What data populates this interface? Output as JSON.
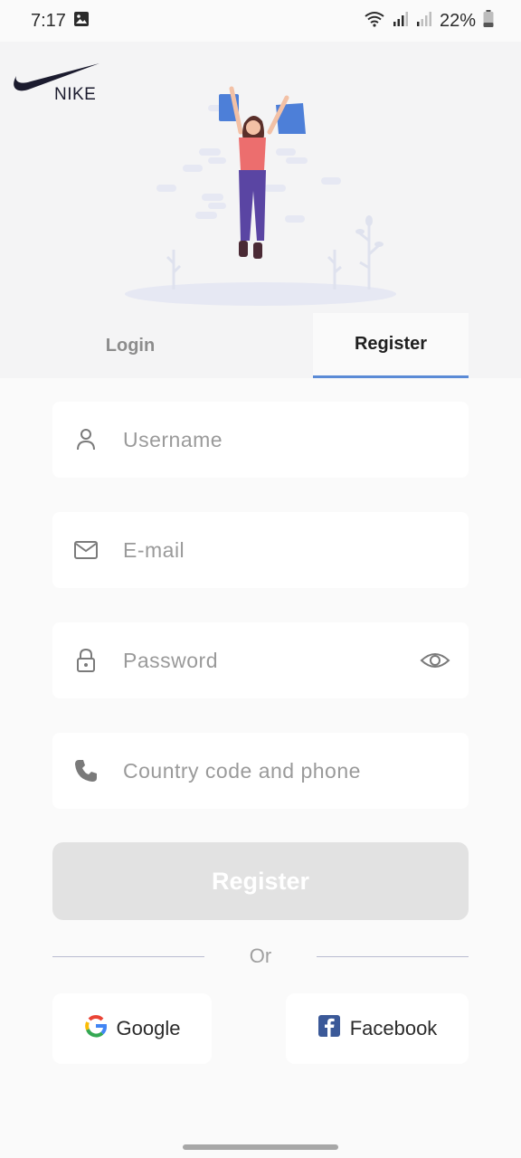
{
  "status_bar": {
    "time": "7:17",
    "battery": "22%",
    "icons": [
      "image-icon",
      "wifi-icon",
      "signal-icon",
      "signal-icon-2",
      "battery-icon"
    ]
  },
  "logo": {
    "text": "NIKE"
  },
  "tabs": {
    "login": "Login",
    "register": "Register",
    "active": "register"
  },
  "form": {
    "username_placeholder": "Username",
    "email_placeholder": "E-mail",
    "password_placeholder": "Password",
    "phone_placeholder": "Country code and phone"
  },
  "register_button": "Register",
  "divider_text": "Or",
  "social": {
    "google": "Google",
    "facebook": "Facebook"
  },
  "colors": {
    "accent": "#5b8bd6",
    "illustration_bags": "#4d7fd8",
    "illustration_shirt": "#ec6e6e",
    "illustration_pants": "#5a45a3",
    "facebook": "#3b5998"
  }
}
